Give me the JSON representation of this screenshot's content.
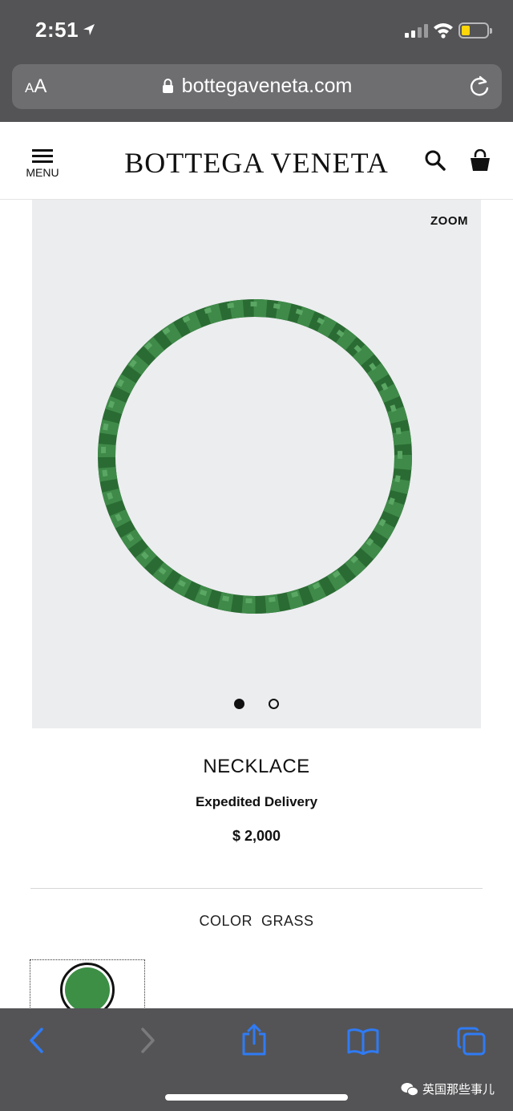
{
  "status_bar": {
    "time": "2:51"
  },
  "browser": {
    "font_button": "AA",
    "url": "bottegaveneta.com"
  },
  "header": {
    "menu_label": "MENU",
    "brand": "BOTTEGA VENETA"
  },
  "product": {
    "zoom_label": "ZOOM",
    "image_count": 2,
    "active_image": 1,
    "name": "NECKLACE",
    "delivery": "Expedited Delivery",
    "price": "$ 2,000",
    "color_label": "COLOR  GRASS",
    "swatch_color": "#3c8f45"
  },
  "toolbar": {
    "icons": [
      "back-icon",
      "forward-icon",
      "share-icon",
      "bookmarks-icon",
      "tabs-icon"
    ]
  },
  "watermark": {
    "text": "英国那些事儿"
  }
}
